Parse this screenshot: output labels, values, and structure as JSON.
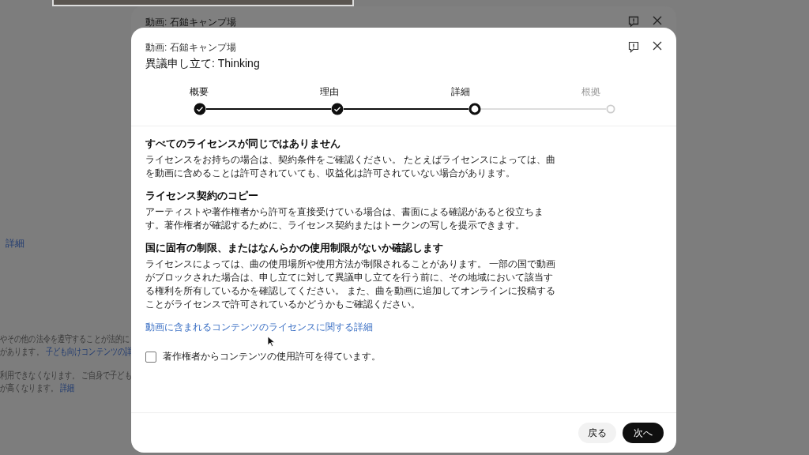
{
  "background": {
    "detail_link": "詳細",
    "lines": [
      {
        "parts": [
          {
            "text": "やその他の法令を遵守することが法的に",
            "kind": "text"
          }
        ]
      },
      {
        "parts": [
          {
            "text": "があります。",
            "kind": "text"
          },
          {
            "text": "子ども向けコンテンツの詳",
            "kind": "link"
          }
        ]
      },
      {
        "parts": [
          {
            "text": "利用できなくなります。 ご自身で子ども",
            "kind": "text"
          }
        ]
      },
      {
        "parts": [
          {
            "text": "が高くなります。",
            "kind": "text"
          },
          {
            "text": "詳細",
            "kind": "link"
          }
        ]
      }
    ],
    "behind_dialog": {
      "subtitle": "動画: 石鎚キャンプ場"
    }
  },
  "dialog": {
    "subtitle": "動画: 石鎚キャンプ場",
    "title": "異議申し立て: Thinking",
    "steps": [
      {
        "label": "概要",
        "completed": true,
        "selected": false
      },
      {
        "label": "理由",
        "completed": true,
        "selected": false
      },
      {
        "label": "詳細",
        "completed": false,
        "selected": true
      },
      {
        "label": "根拠",
        "completed": false,
        "selected": false
      }
    ],
    "sections": [
      {
        "heading": "すべてのライセンスが同じではありません",
        "body": "ライセンスをお持ちの場合は、契約条件をご確認ください。 たとえばライセンスによっては、曲を動画に含めることは許可されていても、収益化は許可されていない場合があります。"
      },
      {
        "heading": "ライセンス契約のコピー",
        "body": "アーティストや著作権者から許可を直接受けている場合は、書面による確認があると役立ちます。著作権者が確認するために、ライセンス契約またはトークンの写しを提示できます。"
      },
      {
        "heading": "国に固有の制限、またはなんらかの使用制限がないか確認します",
        "body": "ライセンスによっては、曲の使用場所や使用方法が制限されることがあります。 一部の国で動画がブロックされた場合は、申し立てに対して異議申し立てを行う前に、その地域において該当する権利を所有しているかを確認してください。 また、曲を動画に追加してオンラインに投稿することがライセンスで許可されているかどうかもご確認ください。"
      }
    ],
    "link": "動画に含まれるコンテンツのライセンスに関する詳細",
    "checkbox": {
      "label": "著作権者からコンテンツの使用許可を得ています。",
      "checked": false
    },
    "buttons": [
      {
        "label": "戻る",
        "kind": "secondary"
      },
      {
        "label": "次へ",
        "kind": "primary"
      }
    ]
  }
}
